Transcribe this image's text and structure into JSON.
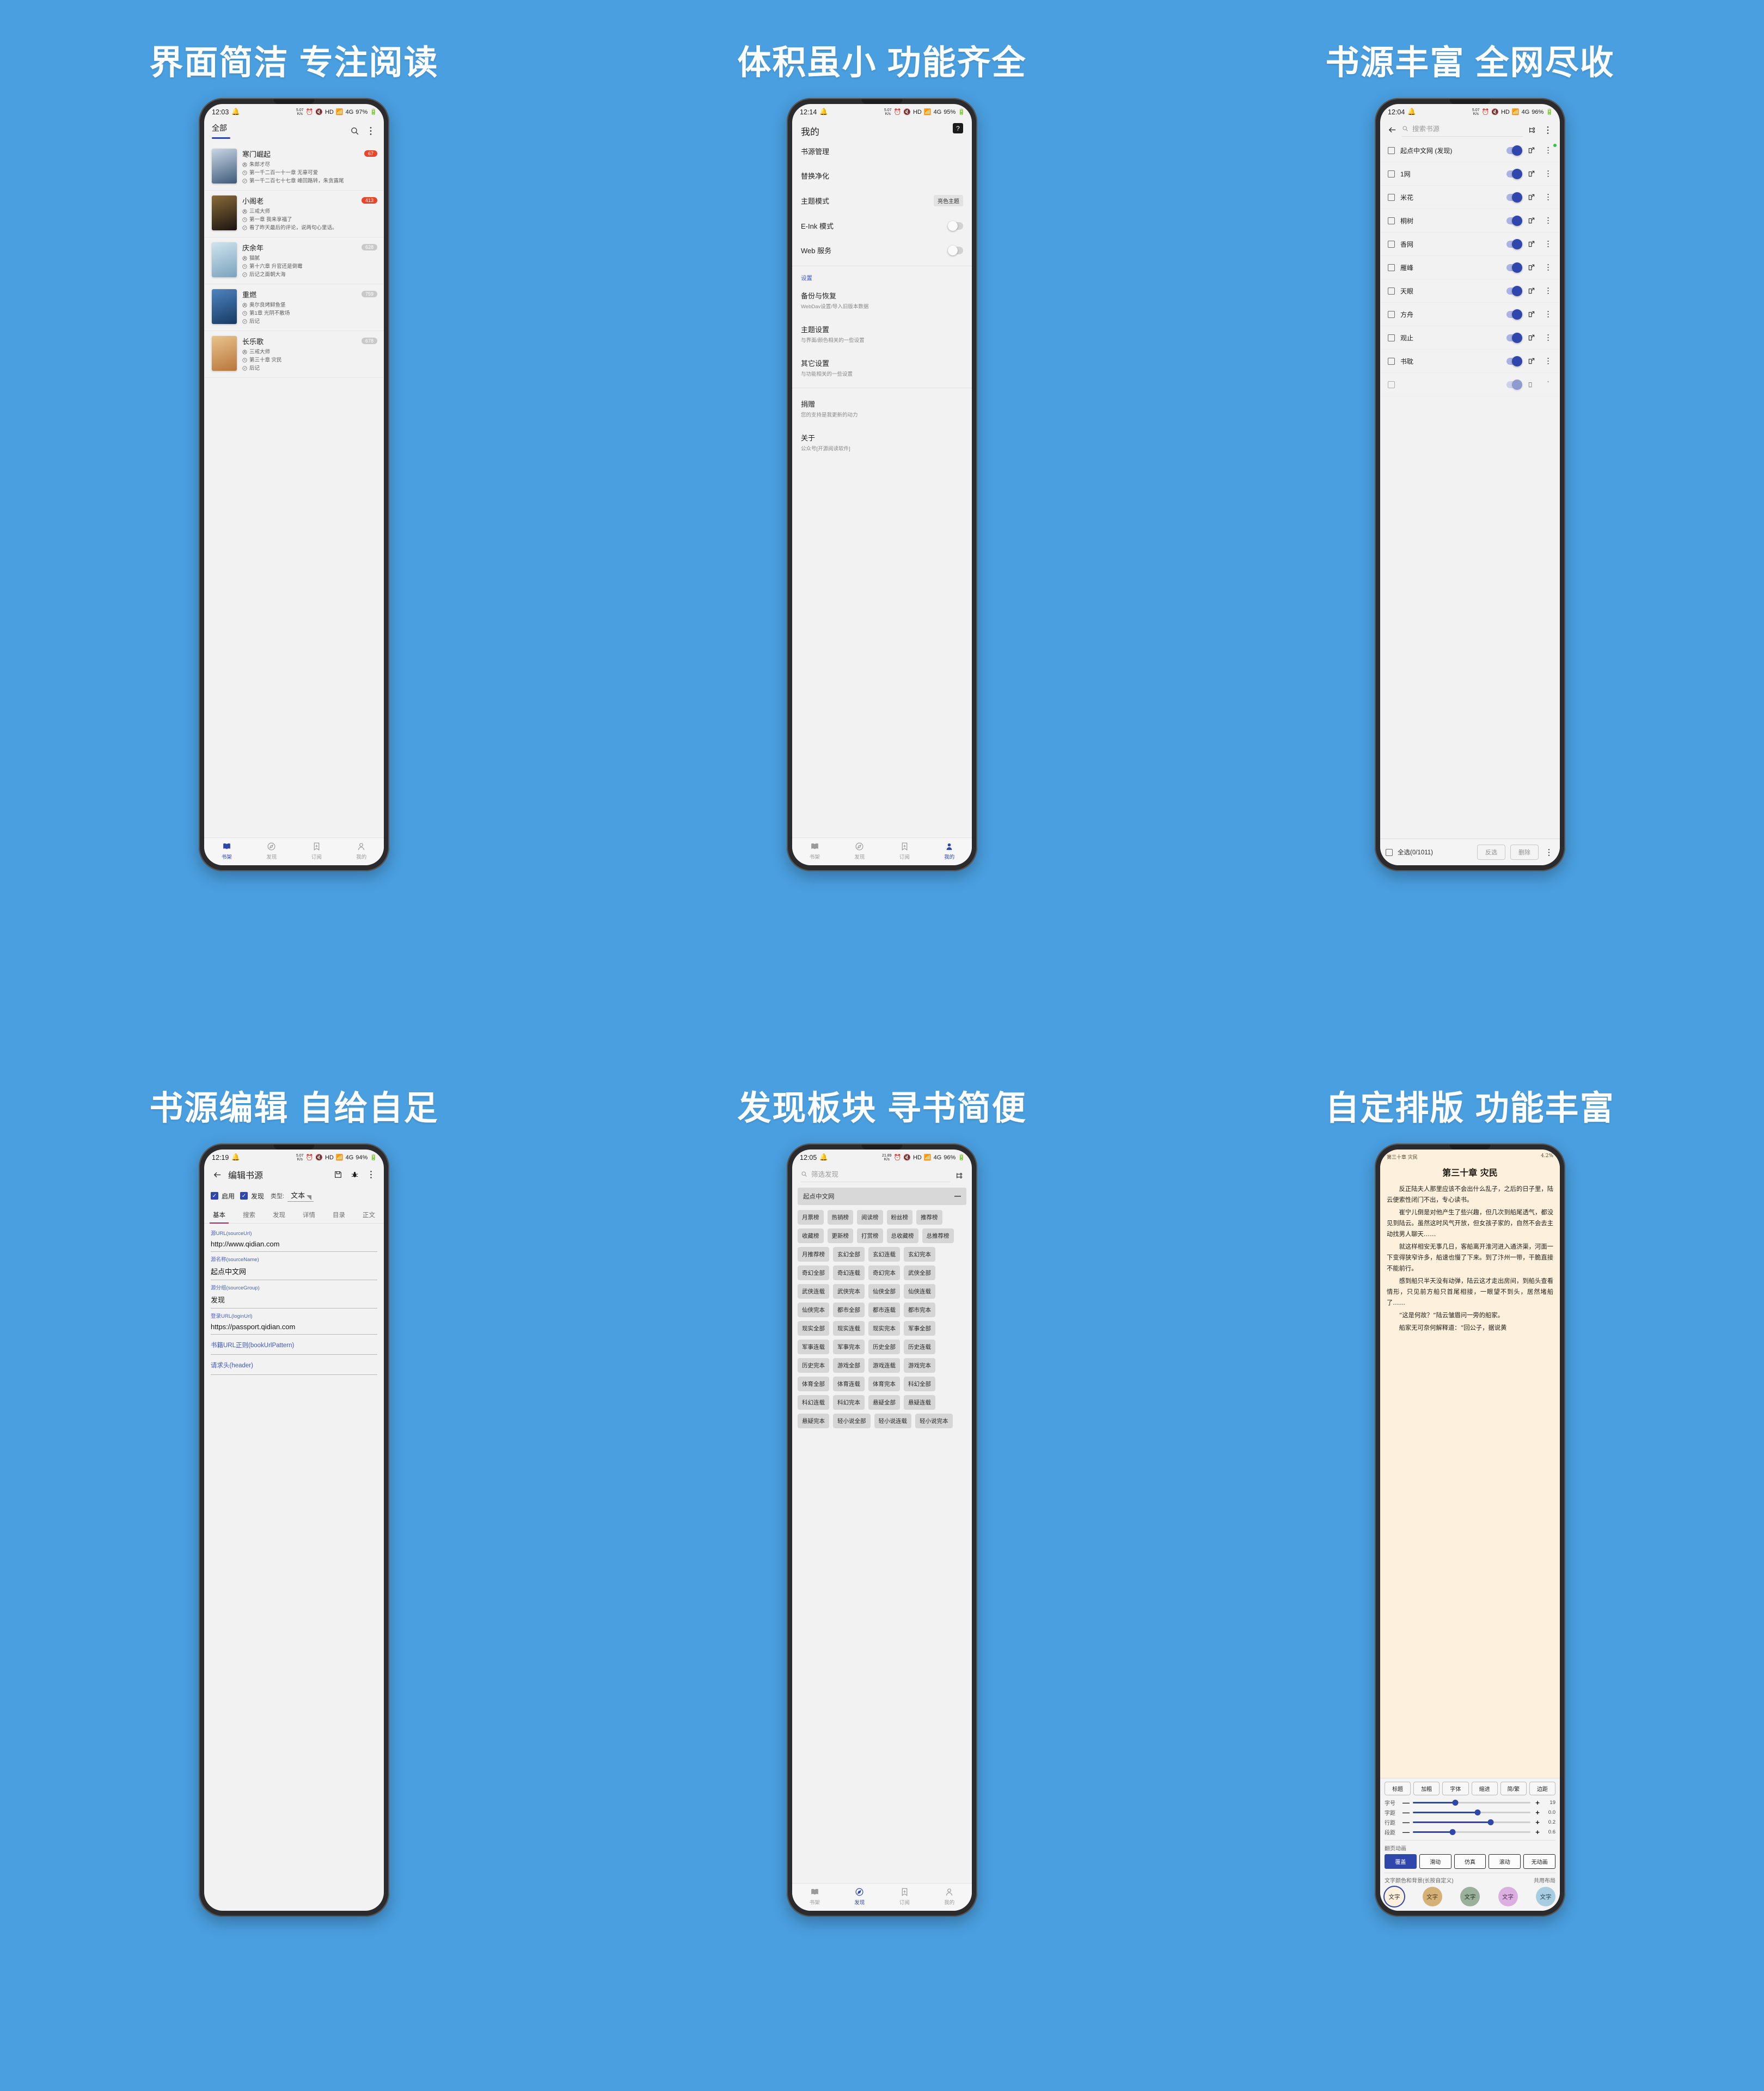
{
  "panels": [
    {
      "headline": "界面简洁  专注阅读"
    },
    {
      "headline": "体积虽小  功能齐全"
    },
    {
      "headline": "书源丰富  全网尽收"
    },
    {
      "headline": "书源编辑  自给自足"
    },
    {
      "headline": "发现板块  寻书简便"
    },
    {
      "headline": "自定排版  功能丰富"
    }
  ],
  "colors": {
    "background": "#4a9fe0",
    "accent": "#2f46ad",
    "badge_red": "#e8452c",
    "tab_indicator": "#b0235c",
    "reader_bg": "#fdf0dc"
  },
  "bottom_nav": {
    "items": [
      {
        "label": "书架",
        "icon": "book-icon"
      },
      {
        "label": "发现",
        "icon": "compass-icon"
      },
      {
        "label": "订阅",
        "icon": "bookmark-plus-icon"
      },
      {
        "label": "我的",
        "icon": "person-icon"
      }
    ]
  },
  "shelf": {
    "status": {
      "time": "12:03",
      "speed_value": "5.07",
      "speed_unit": "K/s",
      "network": "4G",
      "hd": "HD",
      "battery": "97%"
    },
    "tab_label": "全部",
    "search_icon": "search-icon",
    "more_icon": "more-vertical-icon",
    "books": [
      {
        "title": "寒门崛起",
        "author": "朱郎才尽",
        "current": "第一千二百一十一章 无辜可爱",
        "latest": "第一千二百七十七章 峰回路转，朱贪露尾",
        "badge": "67",
        "badge_style": "red",
        "cover_from": "#3e5a7a",
        "cover_to": "#c9d6e4"
      },
      {
        "title": "小阁老",
        "author": "三戒大师",
        "current": "第一章 我来享福了",
        "latest": "看了昨天最后的评论，说两句心里话。",
        "badge": "413",
        "badge_style": "red",
        "cover_from": "#8a6a3a",
        "cover_to": "#1a1410"
      },
      {
        "title": "庆余年",
        "author": "猫腻",
        "current": "第十六章 升官还是倒霉",
        "latest": "后记之面朝大海",
        "badge": "628",
        "badge_style": "grey",
        "cover_from": "#cfe3ee",
        "cover_to": "#7ba3bd"
      },
      {
        "title": "重燃",
        "author": "奥尔良烤鲟鱼堡",
        "current": "第1章 光阴不散场",
        "latest": "后记",
        "badge": "759",
        "badge_style": "grey",
        "cover_from": "#173a63",
        "cover_to": "#4d84c0"
      },
      {
        "title": "长乐歌",
        "author": "三戒大师",
        "current": "第三十章 灾民",
        "latest": "后记",
        "badge": "678",
        "badge_style": "grey",
        "cover_from": "#e9c38d",
        "cover_to": "#b8763c"
      }
    ],
    "active_nav": 0
  },
  "mine": {
    "status": {
      "time": "12:14",
      "speed_value": "5.07",
      "speed_unit": "K/s",
      "network": "4G",
      "hd": "HD",
      "battery": "95%"
    },
    "title": "我的",
    "help_icon": "help-badge-icon",
    "rows": [
      {
        "label": "书源管理",
        "type": "plain"
      },
      {
        "label": "替换净化",
        "type": "plain"
      },
      {
        "label": "主题模式",
        "type": "value",
        "value": "亮色主题"
      },
      {
        "label": "E-Ink 模式",
        "type": "switch",
        "on": false
      },
      {
        "label": "Web 服务",
        "type": "switch",
        "on": false
      }
    ],
    "group_label": "设置",
    "settings": [
      {
        "label": "备份与恢复",
        "sub": "WebDav设置/导入旧版本数据"
      },
      {
        "label": "主题设置",
        "sub": "与界面/颜色相关的一些设置"
      },
      {
        "label": "其它设置",
        "sub": "与功能相关的一些设置"
      }
    ],
    "footer": [
      {
        "label": "捐赠",
        "sub": "您的支持是我更新的动力"
      },
      {
        "label": "关于",
        "sub": "公众号[开源阅读软件]"
      }
    ],
    "active_nav": 3
  },
  "sources": {
    "status": {
      "time": "12:04",
      "speed_value": "5.07",
      "speed_unit": "K/s",
      "network": "4G",
      "hd": "HD",
      "battery": "96%"
    },
    "back_icon": "arrow-left-icon",
    "search_icon": "search-icon",
    "search_placeholder": "搜索书源",
    "group_icon": "group-icon",
    "more_icon": "more-vertical-icon",
    "items": [
      {
        "name": "起点中文网 (发现)",
        "enabled": true,
        "has_dot": true
      },
      {
        "name": "1网",
        "enabled": true,
        "has_dot": false
      },
      {
        "name": "米花",
        "enabled": true,
        "has_dot": false
      },
      {
        "name": "桐树",
        "enabled": true,
        "has_dot": false
      },
      {
        "name": "香网",
        "enabled": true,
        "has_dot": false
      },
      {
        "name": "雁峰",
        "enabled": true,
        "has_dot": false
      },
      {
        "name": "天眼",
        "enabled": true,
        "has_dot": false
      },
      {
        "name": "方舟",
        "enabled": true,
        "has_dot": false
      },
      {
        "name": "观止",
        "enabled": true,
        "has_dot": false
      },
      {
        "name": "书耽",
        "enabled": true,
        "has_dot": false
      }
    ],
    "select_all_label": "全选(0/1011)",
    "invert_label": "反选",
    "delete_label": "删除",
    "row_menu_icon": "more-vertical-icon",
    "row_edit_icon": "edit-icon"
  },
  "editor": {
    "status": {
      "time": "12:19",
      "speed_value": "5.07",
      "speed_unit": "K/s",
      "network": "4G",
      "hd": "HD",
      "battery": "94%"
    },
    "back_icon": "arrow-left-icon",
    "title": "编辑书源",
    "save_icon": "save-icon",
    "debug_icon": "bug-icon",
    "more_icon": "more-vertical-icon",
    "enable_label": "启用",
    "discover_label": "发现",
    "type_label": "类型:",
    "type_value": "文本",
    "tabs": [
      "基本",
      "搜索",
      "发现",
      "详情",
      "目录",
      "正文"
    ],
    "active_tab": 0,
    "fields": [
      {
        "label": "源URL(sourceUrl)",
        "value": "http://www.qidian.com"
      },
      {
        "label": "源名称(sourceName)",
        "value": "起点中文网"
      },
      {
        "label": "源分组(sourceGroup)",
        "value": "发现"
      },
      {
        "label": "登录URL(loginUrl)",
        "value": "https://passport.qidian.com"
      }
    ],
    "empty_fields": [
      "书籍URL正则(bookUrlPattern)",
      "请求头(header)"
    ]
  },
  "discover": {
    "status": {
      "time": "12:05",
      "speed_value": "21.89",
      "speed_unit": "K/s",
      "network": "4G",
      "hd": "HD",
      "battery": "96%"
    },
    "search_icon": "search-icon",
    "search_placeholder": "筛选发现",
    "group_icon": "group-icon",
    "source_name": "起点中文网",
    "collapse_icon": "minus-icon",
    "chips": [
      "月票榜",
      "热销榜",
      "阅读榜",
      "粉丝榜",
      "推荐榜",
      "收藏榜",
      "更新榜",
      "打赏榜",
      "总收藏榜",
      "总推荐榜",
      "月推荐榜",
      "玄幻全部",
      "玄幻连载",
      "玄幻完本",
      "奇幻全部",
      "奇幻连载",
      "奇幻完本",
      "武侠全部",
      "武侠连载",
      "武侠完本",
      "仙侠全部",
      "仙侠连载",
      "仙侠完本",
      "都市全部",
      "都市连载",
      "都市完本",
      "现实全部",
      "现实连载",
      "现实完本",
      "军事全部",
      "军事连载",
      "军事完本",
      "历史全部",
      "历史连载",
      "历史完本",
      "游戏全部",
      "游戏连载",
      "游戏完本",
      "体育全部",
      "体育连载",
      "体育完本",
      "科幻全部",
      "科幻连载",
      "科幻完本",
      "悬疑全部",
      "悬疑连载",
      "悬疑完本",
      "轻小说全部",
      "轻小说连载",
      "轻小说完本"
    ],
    "active_nav": 1
  },
  "reader": {
    "chapter_label": "第三十章 灾民",
    "progress": "4.2%",
    "title": "第三十章 灾民",
    "paragraphs": [
      "反正陆夫人那里应该不会出什么乱子，之后的日子里，陆云便索性闭门不出，专心读书。",
      "崔宁儿倒是对他产生了些兴趣，但几次到船尾透气，都没见到陆云。虽然这时风气开放，但女孩子家的，自然不会去主动找男人聊天……",
      "就这样相安无事几日，客船离开淮河进入通济渠，河面一下变得狭窄许多，船速也慢了下来。到了汴州一带，干脆直接不能前行。",
      "感到船只半天没有动弹，陆云这才走出房间，到船头查看情形，只见前方船只首尾相接，一眼望不到头，居然堵船了……",
      "“这是何故？”陆云皱眉问一旁的船家。",
      "船家无可奈何解释道：“回公子，据说黄"
    ],
    "quick_buttons": [
      "标题",
      "加粗",
      "字体",
      "缩进",
      "简/繁",
      "边距"
    ],
    "sliders": [
      {
        "label": "字号",
        "value": "19",
        "percent": 36
      },
      {
        "label": "字距",
        "value": "0.0",
        "percent": 55
      },
      {
        "label": "行距",
        "value": "0.2",
        "percent": 66
      },
      {
        "label": "段距",
        "value": "0.6",
        "percent": 34
      }
    ],
    "anim_label": "翻页动画",
    "anim_options": [
      "覆盖",
      "滑动",
      "仿真",
      "滚动",
      "无动画"
    ],
    "anim_selected": 0,
    "color_label": "文字颜色和背景(长按自定义)",
    "shared_layout_label": "共用布局",
    "swatch_text": "文字",
    "swatches": [
      {
        "bg": "#fdf0dc",
        "fg": "#2b2b2b",
        "selected": true
      },
      {
        "bg": "#d5b077",
        "fg": "#4b3a1c",
        "selected": false
      },
      {
        "bg": "#9bb09b",
        "fg": "#22331f",
        "selected": false
      },
      {
        "bg": "#dbb0e0",
        "fg": "#4a2a4e",
        "selected": false
      },
      {
        "bg": "#a8cde0",
        "fg": "#1d3c4d",
        "selected": false
      }
    ]
  }
}
